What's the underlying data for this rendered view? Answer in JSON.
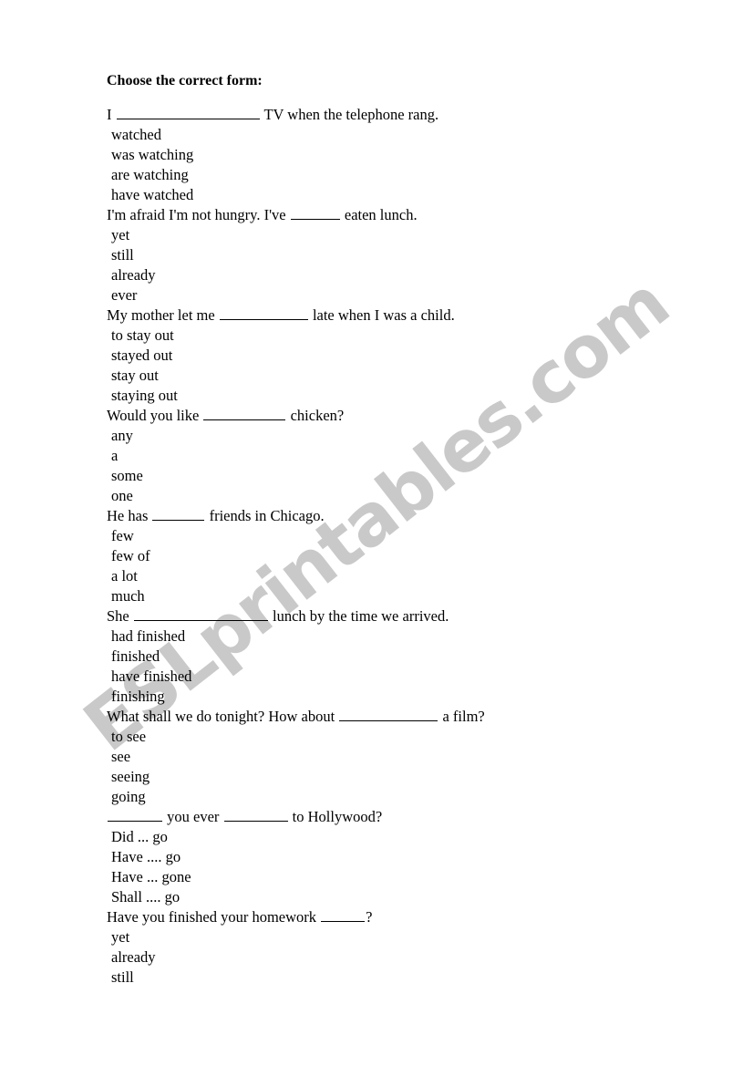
{
  "document": {
    "title": "Choose the correct form:",
    "watermark": "ESLprintables.com",
    "watermark_color": "#c9c9c9",
    "text_color": "#000000",
    "background_color": "#ffffff"
  },
  "questions": [
    {
      "prefix": "I",
      "blank_width": 157,
      "suffix": "TV when the telephone rang.",
      "second_blank_width": 0,
      "tail": "",
      "options": [
        "watched",
        "was watching",
        "are watching",
        "have watched"
      ]
    },
    {
      "prefix": "I'm afraid I'm not hungry. I've",
      "blank_width": 54,
      "suffix": "eaten lunch.",
      "second_blank_width": 0,
      "tail": "",
      "options": [
        "yet",
        "still",
        "already",
        "ever"
      ]
    },
    {
      "prefix": "My mother let me",
      "blank_width": 97,
      "suffix": "late when I was a child.",
      "second_blank_width": 0,
      "tail": "",
      "options": [
        "to stay out",
        "stayed out",
        "stay out",
        "staying out"
      ]
    },
    {
      "prefix": "Would you like",
      "blank_width": 90,
      "suffix": "chicken?",
      "second_blank_width": 0,
      "tail": "",
      "options": [
        "any",
        "a",
        "some",
        "one"
      ]
    },
    {
      "prefix": "He has",
      "blank_width": 57,
      "suffix": "friends in Chicago.",
      "second_blank_width": 0,
      "tail": "",
      "options": [
        "few",
        "few of",
        "a lot",
        "much"
      ]
    },
    {
      "prefix": "She",
      "blank_width": 147,
      "suffix": "lunch by the time we arrived.",
      "second_blank_width": 0,
      "tail": "",
      "options": [
        "had finished",
        "finished",
        "have finished",
        "finishing"
      ]
    },
    {
      "prefix": "What shall we do tonight? How about",
      "blank_width": 108,
      "suffix": "a film?",
      "second_blank_width": 0,
      "tail": "",
      "options": [
        "to see",
        "see",
        "seeing",
        "going"
      ]
    },
    {
      "prefix": "",
      "blank_width": 60,
      "suffix": "you ever",
      "second_blank_width": 70,
      "tail": "to Hollywood?",
      "options": [
        "Did ... go",
        "Have ....  go",
        "Have ... gone",
        "Shall ....  go"
      ]
    },
    {
      "prefix": "Have you finished your homework",
      "blank_width": 48,
      "suffix": "?",
      "second_blank_width": 0,
      "tail": "",
      "options": [
        "yet",
        "already",
        "still"
      ]
    }
  ]
}
